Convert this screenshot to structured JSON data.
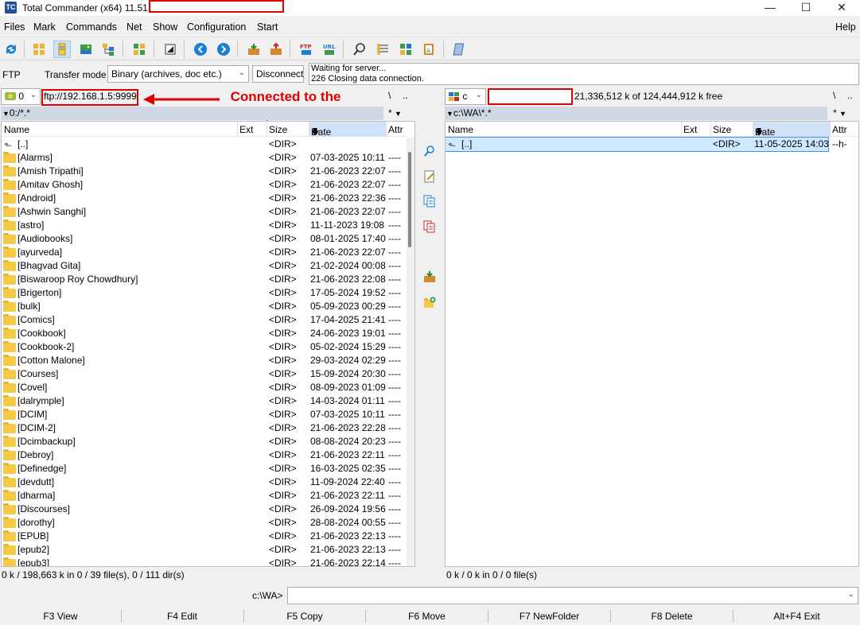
{
  "titlebar": {
    "title": "Total Commander (x64) 11.51"
  },
  "menu": [
    "Files",
    "Mark",
    "Commands",
    "Net",
    "Show",
    "Configuration",
    "Start",
    "Help"
  ],
  "ftp": {
    "label": "FTP",
    "transfer_mode_label": "Transfer mode",
    "transfer_mode_value": "Binary (archives, doc etc.)",
    "disconnect_label": "Disconnect",
    "log_line1": "Waiting for server...",
    "log_line2": "226 Closing data connection."
  },
  "left": {
    "drive": "0",
    "path_input": "ftp://192.168.1.5:9999",
    "path_header": "0:/*.*",
    "columns": {
      "name": "Name",
      "ext": "Ext",
      "size": "Size",
      "date": "Date",
      "attr": "Attr"
    },
    "status": "0 k / 198,663 k in 0 / 39 file(s), 0 / 111 dir(s)",
    "rows": [
      {
        "name": "[..]",
        "size": "<DIR>",
        "date": "",
        "attr": ""
      },
      {
        "name": "[Alarms]",
        "size": "<DIR>",
        "date": "07-03-2025 10:11",
        "attr": "----"
      },
      {
        "name": "[Amish Tripathi]",
        "size": "<DIR>",
        "date": "21-06-2023 22:07",
        "attr": "----"
      },
      {
        "name": "[Amitav Ghosh]",
        "size": "<DIR>",
        "date": "21-06-2023 22:07",
        "attr": "----"
      },
      {
        "name": "[Android]",
        "size": "<DIR>",
        "date": "21-06-2023 22:36",
        "attr": "----"
      },
      {
        "name": "[Ashwin Sanghi]",
        "size": "<DIR>",
        "date": "21-06-2023 22:07",
        "attr": "----"
      },
      {
        "name": "[astro]",
        "size": "<DIR>",
        "date": "11-11-2023 19:08",
        "attr": "----"
      },
      {
        "name": "[Audiobooks]",
        "size": "<DIR>",
        "date": "08-01-2025 17:40",
        "attr": "----"
      },
      {
        "name": "[ayurveda]",
        "size": "<DIR>",
        "date": "21-06-2023 22:07",
        "attr": "----"
      },
      {
        "name": "[Bhagvad Gita]",
        "size": "<DIR>",
        "date": "21-02-2024 00:08",
        "attr": "----"
      },
      {
        "name": "[Biswaroop Roy Chowdhury]",
        "size": "<DIR>",
        "date": "21-06-2023 22:08",
        "attr": "----"
      },
      {
        "name": "[Brigerton]",
        "size": "<DIR>",
        "date": "17-05-2024 19:52",
        "attr": "----"
      },
      {
        "name": "[bulk]",
        "size": "<DIR>",
        "date": "05-09-2023 00:29",
        "attr": "----"
      },
      {
        "name": "[Comics]",
        "size": "<DIR>",
        "date": "17-04-2025 21:41",
        "attr": "----"
      },
      {
        "name": "[Cookbook]",
        "size": "<DIR>",
        "date": "24-06-2023 19:01",
        "attr": "----"
      },
      {
        "name": "[Cookbook-2]",
        "size": "<DIR>",
        "date": "05-02-2024 15:29",
        "attr": "----"
      },
      {
        "name": "[Cotton Malone]",
        "size": "<DIR>",
        "date": "29-03-2024 02:29",
        "attr": "----"
      },
      {
        "name": "[Courses]",
        "size": "<DIR>",
        "date": "15-09-2024 20:30",
        "attr": "----"
      },
      {
        "name": "[Covel]",
        "size": "<DIR>",
        "date": "08-09-2023 01:09",
        "attr": "----"
      },
      {
        "name": "[dalrymple]",
        "size": "<DIR>",
        "date": "14-03-2024 01:11",
        "attr": "----"
      },
      {
        "name": "[DCIM]",
        "size": "<DIR>",
        "date": "07-03-2025 10:11",
        "attr": "----"
      },
      {
        "name": "[DCIM-2]",
        "size": "<DIR>",
        "date": "21-06-2023 22:28",
        "attr": "----"
      },
      {
        "name": "[Dcimbackup]",
        "size": "<DIR>",
        "date": "08-08-2024 20:23",
        "attr": "----"
      },
      {
        "name": "[Debroy]",
        "size": "<DIR>",
        "date": "21-06-2023 22:11",
        "attr": "----"
      },
      {
        "name": "[Definedge]",
        "size": "<DIR>",
        "date": "16-03-2025 02:35",
        "attr": "----"
      },
      {
        "name": "[devdutt]",
        "size": "<DIR>",
        "date": "11-09-2024 22:40",
        "attr": "----"
      },
      {
        "name": "[dharma]",
        "size": "<DIR>",
        "date": "21-06-2023 22:11",
        "attr": "----"
      },
      {
        "name": "[Discourses]",
        "size": "<DIR>",
        "date": "26-09-2024 19:56",
        "attr": "----"
      },
      {
        "name": "[dorothy]",
        "size": "<DIR>",
        "date": "28-08-2024 00:55",
        "attr": "----"
      },
      {
        "name": "[EPUB]",
        "size": "<DIR>",
        "date": "21-06-2023 22:13",
        "attr": "----"
      },
      {
        "name": "[epub2]",
        "size": "<DIR>",
        "date": "21-06-2023 22:13",
        "attr": "----"
      },
      {
        "name": "[epub3]",
        "size": "<DIR>",
        "date": "21-06-2023 22:14",
        "attr": "----"
      }
    ]
  },
  "right": {
    "drive": "c",
    "free_space": "21,336,512 k of 124,444,912 k free",
    "path_header": "c:\\WA\\*.*",
    "columns": {
      "name": "Name",
      "ext": "Ext",
      "size": "Size",
      "date": "Date",
      "attr": "Attr"
    },
    "status": "0 k / 0 k in 0 / 0 file(s)",
    "rows": [
      {
        "name": "[..]",
        "size": "<DIR>",
        "date": "11-05-2025 14:03",
        "attr": "--h-"
      }
    ]
  },
  "pane_nav": {
    "root": "\\",
    "up": "..",
    "star": "*"
  },
  "annotation": "Connected to the phone",
  "cmdline": {
    "prompt": "c:\\WA>",
    "value": ""
  },
  "fkeys": [
    "F3 View",
    "F4 Edit",
    "F5 Copy",
    "F6 Move",
    "F7 NewFolder",
    "F8 Delete",
    "Alt+F4 Exit"
  ],
  "colors": {
    "annotation": "#e00000",
    "path_header_bg": "#cfd8e4",
    "selected_row": "#cde8ff"
  }
}
